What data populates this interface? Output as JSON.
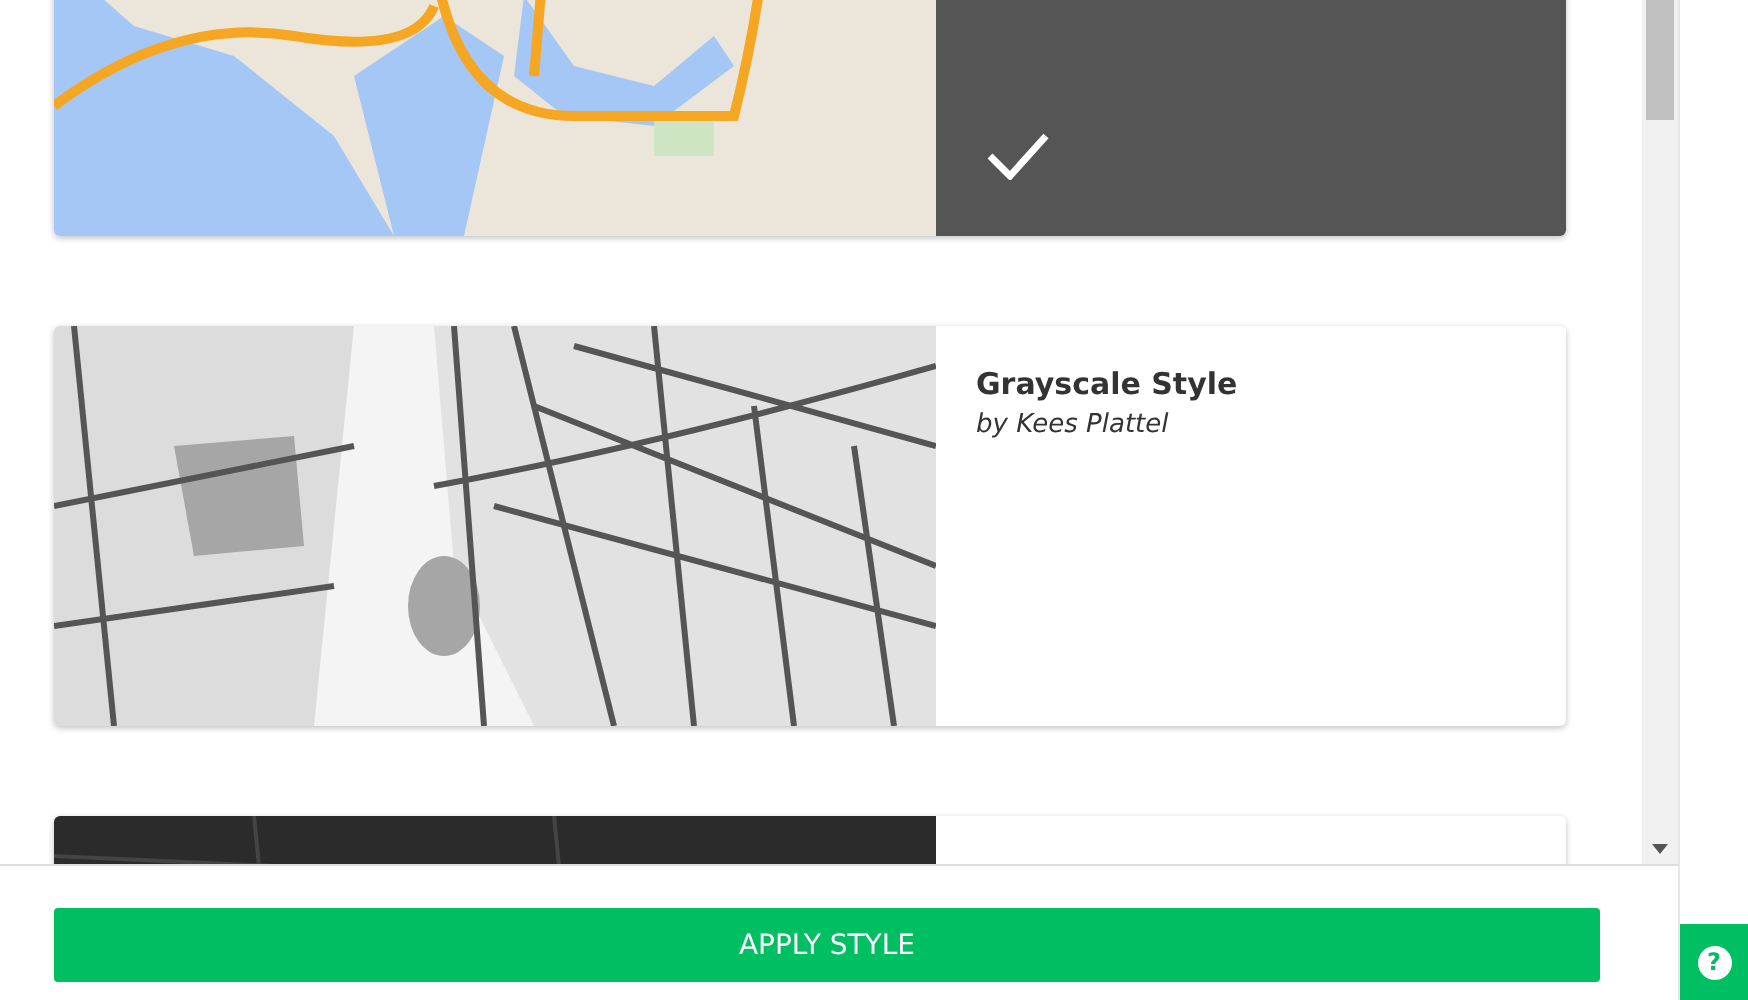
{
  "styles": [
    {
      "kind": "color",
      "selected": true
    },
    {
      "kind": "grayscale",
      "selected": false,
      "title": "Grayscale Style",
      "author": "by Kees Plattel"
    },
    {
      "kind": "dark",
      "selected": false
    }
  ],
  "apply_button": "APPLY STYLE",
  "help_button": "?"
}
